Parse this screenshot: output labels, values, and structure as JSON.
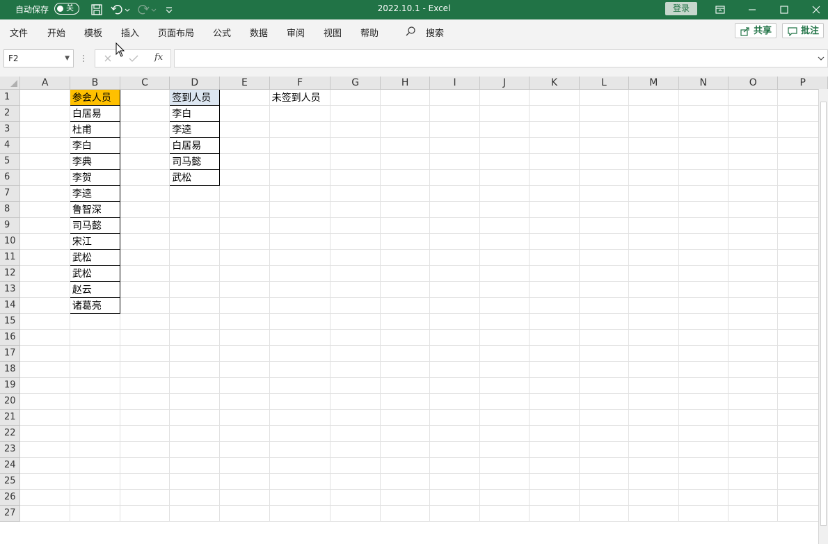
{
  "titlebar": {
    "autosave_label": "自动保存",
    "autosave_state": "关",
    "doc_title": "2022.10.1  -  Excel",
    "login_label": "登录"
  },
  "menu": {
    "items": [
      "文件",
      "开始",
      "模板",
      "插入",
      "页面布局",
      "公式",
      "数据",
      "审阅",
      "视图",
      "帮助"
    ],
    "search_label": "搜索",
    "share_label": "共享",
    "comment_label": "批注"
  },
  "formula_bar": {
    "name_box": "F2",
    "fx_label": "fx",
    "formula": ""
  },
  "sheet": {
    "columns": [
      "A",
      "B",
      "C",
      "D",
      "E",
      "F",
      "G",
      "H",
      "I",
      "J",
      "K",
      "L",
      "M",
      "N",
      "O",
      "P"
    ],
    "rows": [
      "1",
      "2",
      "3",
      "4",
      "5",
      "6",
      "7",
      "8",
      "9",
      "10",
      "11",
      "12",
      "13",
      "14",
      "15",
      "16",
      "17",
      "18",
      "19",
      "20",
      "21",
      "22",
      "23",
      "24",
      "25",
      "26",
      "27"
    ],
    "col_b": [
      "参会人员",
      "白居易",
      "杜甫",
      "李白",
      "李典",
      "李贺",
      "李逵",
      "鲁智深",
      "司马懿",
      "宋江",
      "武松",
      "武松",
      "赵云",
      "诸葛亮"
    ],
    "col_d": [
      "签到人员",
      "李白",
      "李逵",
      "白居易",
      "司马懿",
      "武松"
    ],
    "f1": "未签到人员",
    "colors": {
      "b_header": "#ffc000",
      "d_header": "#dce6f1",
      "accent": "#217346"
    }
  }
}
